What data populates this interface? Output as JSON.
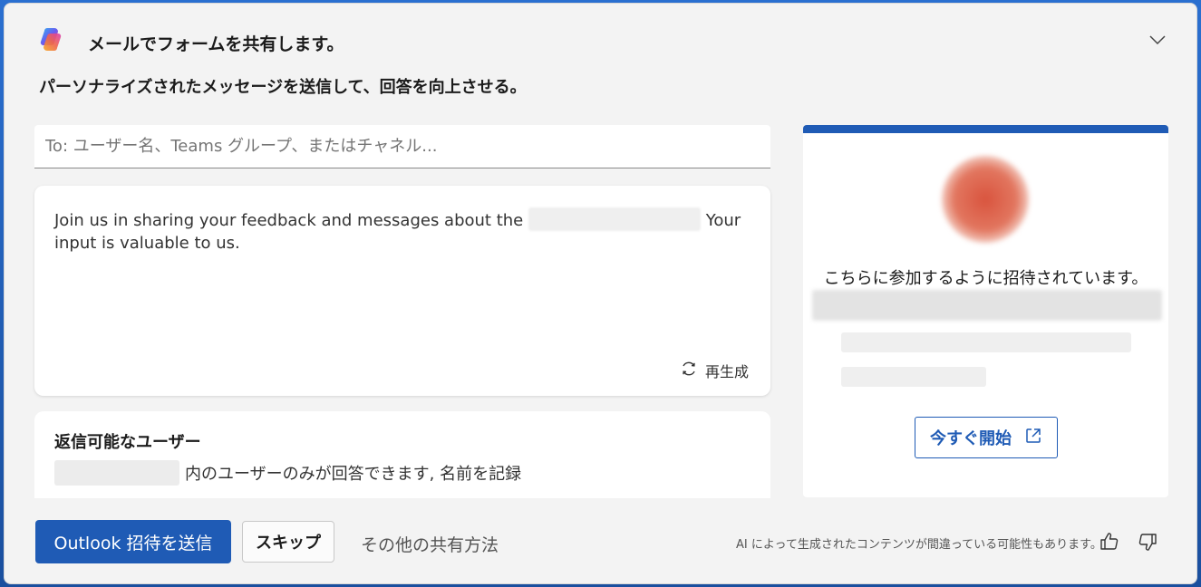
{
  "header": {
    "title": "メールでフォームを共有します。",
    "subtitle": "パーソナライズされたメッセージを送信して、回答を向上させる。"
  },
  "to_field": {
    "placeholder": "To: ユーザー名、Teams グループ、またはチャネル..."
  },
  "message": {
    "text_before": "Join us in sharing your feedback and messages about the",
    "text_after": "Your input is valuable to us.",
    "regenerate_label": "再生成"
  },
  "reply": {
    "title": "返信可能なユーザー",
    "description": "内のユーザーのみが回答できます, 名前を記録"
  },
  "preview": {
    "invite_text": "こちらに参加するように招待されています。",
    "start_button": "今すぐ開始"
  },
  "footer": {
    "send_button": "Outlook 招待を送信",
    "skip_button": "スキップ",
    "other_share": "その他の共有方法",
    "disclaimer": "AI によって生成されたコンテンツが間違っている可能性もあります。"
  },
  "colors": {
    "accent": "#1f5bb5",
    "panel_bg": "#f3f3f3"
  },
  "icons": {
    "logo": "copilot-icon",
    "collapse": "chevron-down-icon",
    "regenerate": "refresh-icon",
    "open_external": "external-link-icon",
    "like": "thumbs-up-icon",
    "dislike": "thumbs-down-icon"
  }
}
